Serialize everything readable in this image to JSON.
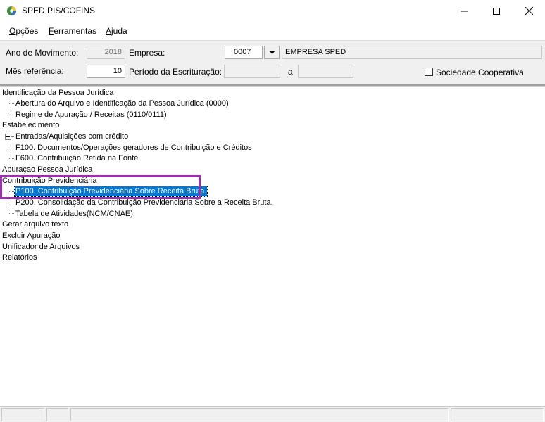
{
  "window": {
    "title": "SPED PIS/COFINS"
  },
  "menu": [
    {
      "accel": "O",
      "rest": "pções"
    },
    {
      "accel": "F",
      "rest": "erramentas"
    },
    {
      "accel": "A",
      "rest": "juda"
    }
  ],
  "header": {
    "ano_label": "Ano de Movimento:",
    "ano_value": "2018",
    "empresa_label": "Empresa:",
    "empresa_code": "0007",
    "empresa_name": "EMPRESA SPED",
    "mes_label": "Mês referência:",
    "mes_value": "10",
    "periodo_label": "Período da Escrituração:",
    "periodo_sep": "a",
    "cooperativa_label": "Sociedade Cooperativa"
  },
  "tree": {
    "n0": "Identificação da Pessoa Jurídica",
    "n1": "Abertura do Arquivo e Identificação da Pessoa Jurídica (0000)",
    "n2": "Regime de Apuração / Receitas (0110/0111)",
    "n3": "Estabelecimento",
    "n4": "Entradas/Aquisições com crédito",
    "n5": "F100. Documentos/Operações geradores de Contribuição e Créditos",
    "n6": "F600. Contribuição Retida na Fonte",
    "n7": "Apuraçao Pessoa Jurídica",
    "n8": "Contribuição Previdenciária",
    "n9": "P100. Contribuição Previdenciária Sobre Receita Bruta.",
    "n10": "P200. Consolidação da Contribuição Previdenciária Sobre a Receita Bruta.",
    "n11": "Tabela de Atividades(NCM/CNAE).",
    "n12": "Gerar arquivo texto",
    "n13": "Excluir Apuração",
    "n14": "Unificador de Arquivos",
    "n15": "Relatórios"
  },
  "colors": {
    "selection": "#0078d7",
    "highlight": "#9b2fae"
  },
  "icons": [
    "app-icon",
    "minimize-icon",
    "maximize-icon",
    "close-icon",
    "dropdown-arrow-icon",
    "expand-plus-icon"
  ]
}
